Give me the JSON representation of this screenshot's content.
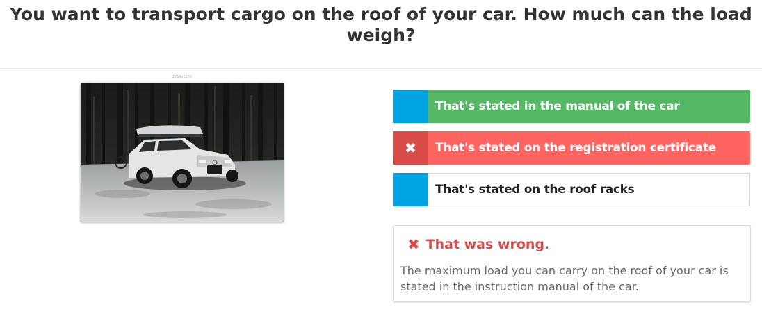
{
  "question": {
    "text": "You want to transport cargo on the roof of your car. How much can the load weigh?"
  },
  "image": {
    "caption": "2754x1255",
    "icon": "car-with-roof-box-photo"
  },
  "answers": [
    {
      "label": "That's stated in the manual of the car",
      "state": "correct",
      "marker": "",
      "color": "#56b865"
    },
    {
      "label": "That's stated on the registration certificate",
      "state": "selected-wrong",
      "marker": "✖",
      "color": "#ff6460"
    },
    {
      "label": "That's stated on the roof racks",
      "state": "neutral",
      "marker": "",
      "color": "#ffffff"
    }
  ],
  "feedback": {
    "icon": "✖",
    "title": "That was wrong.",
    "text": "The maximum load you can carry on the roof of your car is stated in the instruction manual of the car.",
    "color": "#d94c4a"
  },
  "colors": {
    "accent": "#00a3e1",
    "correct": "#56b865",
    "wrong": "#ff6460"
  }
}
